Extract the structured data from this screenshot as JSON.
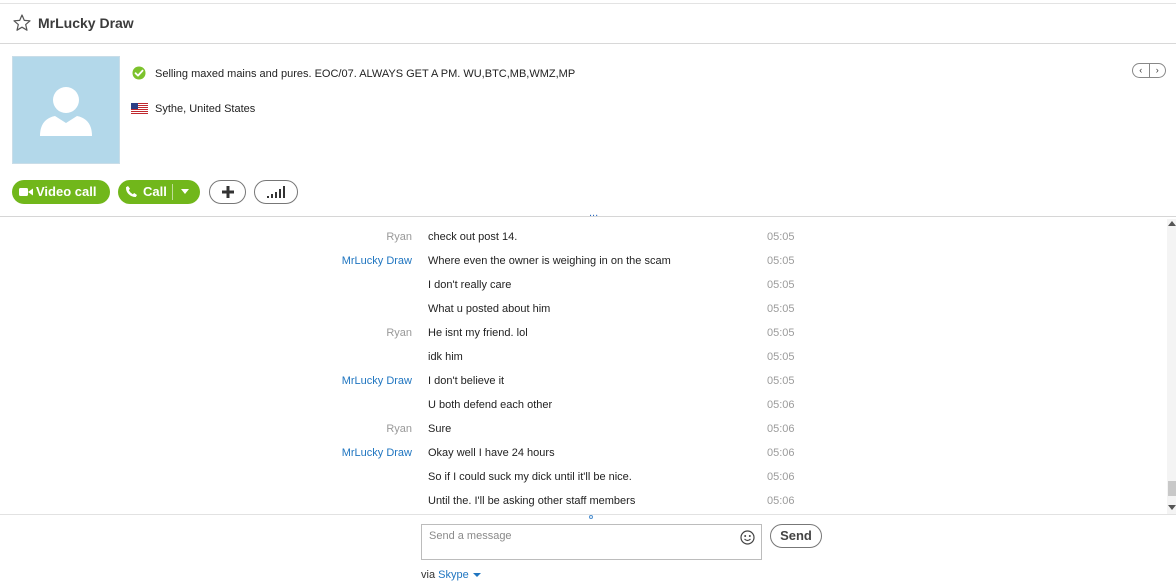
{
  "header": {
    "contact_name": "MrLucky Draw",
    "mood_message": "Selling maxed mains and pures. EOC/07. ALWAYS GET A PM.  WU,BTC,MB,WMZ,MP",
    "location": "Sythe, United States",
    "nav_prev": "‹",
    "nav_next": "›"
  },
  "actions": {
    "video_call_label": "Video call",
    "call_label": "Call"
  },
  "more_indicator": "...",
  "messages": [
    {
      "sender": "Ryan",
      "text": "check out post 14.",
      "time": "05:05"
    },
    {
      "sender": "MrLucky Draw",
      "text": "Where even the owner is weighing in on the scam",
      "time": "05:05"
    },
    {
      "sender": "",
      "text": "I don't really care",
      "time": "05:05"
    },
    {
      "sender": "",
      "text": "What u posted about him",
      "time": "05:05"
    },
    {
      "sender": "Ryan",
      "text": "He isnt my friend. lol",
      "time": "05:05"
    },
    {
      "sender": "",
      "text": "idk him",
      "time": "05:05"
    },
    {
      "sender": "MrLucky Draw",
      "text": "I don't believe it",
      "time": "05:05"
    },
    {
      "sender": "",
      "text": "U both defend each other",
      "time": "05:06"
    },
    {
      "sender": "Ryan",
      "text": "Sure",
      "time": "05:06"
    },
    {
      "sender": "MrLucky Draw",
      "text": "Okay well I have 24 hours",
      "time": "05:06"
    },
    {
      "sender": "",
      "text": "So if I could suck my dick until it'll be nice.",
      "time": "05:06"
    },
    {
      "sender": "",
      "text": "Until the. I'll be asking other staff members",
      "time": "05:06"
    }
  ],
  "composer": {
    "placeholder": "Send a message",
    "send_label": "Send",
    "via_prefix": "via",
    "via_service": "Skype"
  },
  "colors": {
    "green": "#71b71b",
    "link_blue": "#1f75c0",
    "avatar_bg": "#b3d8ea"
  }
}
